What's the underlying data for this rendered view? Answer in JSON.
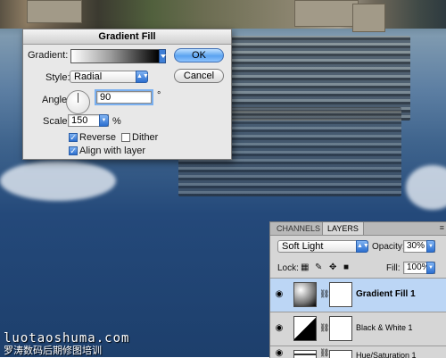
{
  "dialog": {
    "title": "Gradient Fill",
    "gradient_label": "Gradient:",
    "style_label": "Style:",
    "style_value": "Radial",
    "angle_label": "Angle:",
    "angle_value": "90",
    "angle_unit": "°",
    "scale_label": "Scale:",
    "scale_value": "150",
    "scale_unit": "%",
    "reverse_label": "Reverse",
    "reverse_checked": true,
    "dither_label": "Dither",
    "dither_checked": false,
    "align_label": "Align with layer",
    "align_checked": true,
    "ok_label": "OK",
    "cancel_label": "Cancel"
  },
  "panel": {
    "tabs": [
      {
        "label": "CHANNELS",
        "active": false
      },
      {
        "label": "LAYERS",
        "active": true
      }
    ],
    "blend_mode": "Soft Light",
    "opacity_label": "Opacity:",
    "opacity_value": "30%",
    "lock_label": "Lock:",
    "fill_label": "Fill:",
    "fill_value": "100%",
    "layers": [
      {
        "name": "Gradient Fill 1",
        "selected": true
      },
      {
        "name": "Black & White 1",
        "selected": false
      },
      {
        "name": "Hue/Saturation 1",
        "selected": false
      }
    ]
  },
  "watermark": {
    "line1": "luotaoshuma.com",
    "line2": "罗涛数码后期修图培训"
  },
  "icons": {
    "eye": "eye-icon",
    "link": "chain-link-icon",
    "lock_transparent": "lock-transparent-icon",
    "lock_paint": "brush-icon",
    "lock_move": "move-icon",
    "lock_all": "lock-icon",
    "panel_menu": "panel-menu-icon"
  }
}
